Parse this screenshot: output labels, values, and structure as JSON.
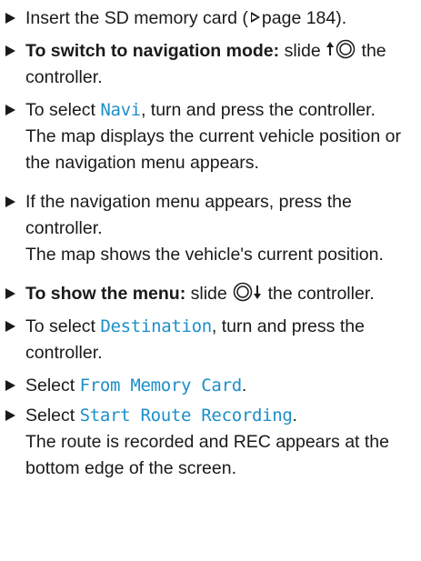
{
  "steps": [
    {
      "text_before": "Insert the SD memory card (",
      "page_ref": "page 184",
      "text_after": ")."
    },
    {
      "bold": "To switch to navigation mode:",
      "text_before": " slide ",
      "text_after": " the controller."
    },
    {
      "text_before": "To select ",
      "mono": "Navi",
      "text_after": ", turn and press the controller.",
      "result": "The map displays the current vehicle position or the navigation menu appears."
    },
    {
      "text_before": "If the navigation menu appears, press the controller.",
      "result": "The map shows the vehicle's current position."
    },
    {
      "bold": "To show the menu:",
      "text_before": " slide ",
      "text_after": " the controller."
    },
    {
      "text_before": "To select ",
      "mono": "Destination",
      "text_after": ", turn and press the controller."
    },
    {
      "text_before": "Select ",
      "mono": "From Memory Card",
      "text_after": "."
    },
    {
      "text_before": "Select ",
      "mono": "Start Route Recording",
      "text_after": ".",
      "result": "The route is recorded and REC appears at the bottom edge of the screen."
    }
  ],
  "icons": {
    "bullet": "right-triangle-bullet-icon",
    "page_ref": "hollow-triangle-icon",
    "slide_up": "slide-up-controller-icon",
    "slide_down": "slide-down-controller-icon"
  }
}
